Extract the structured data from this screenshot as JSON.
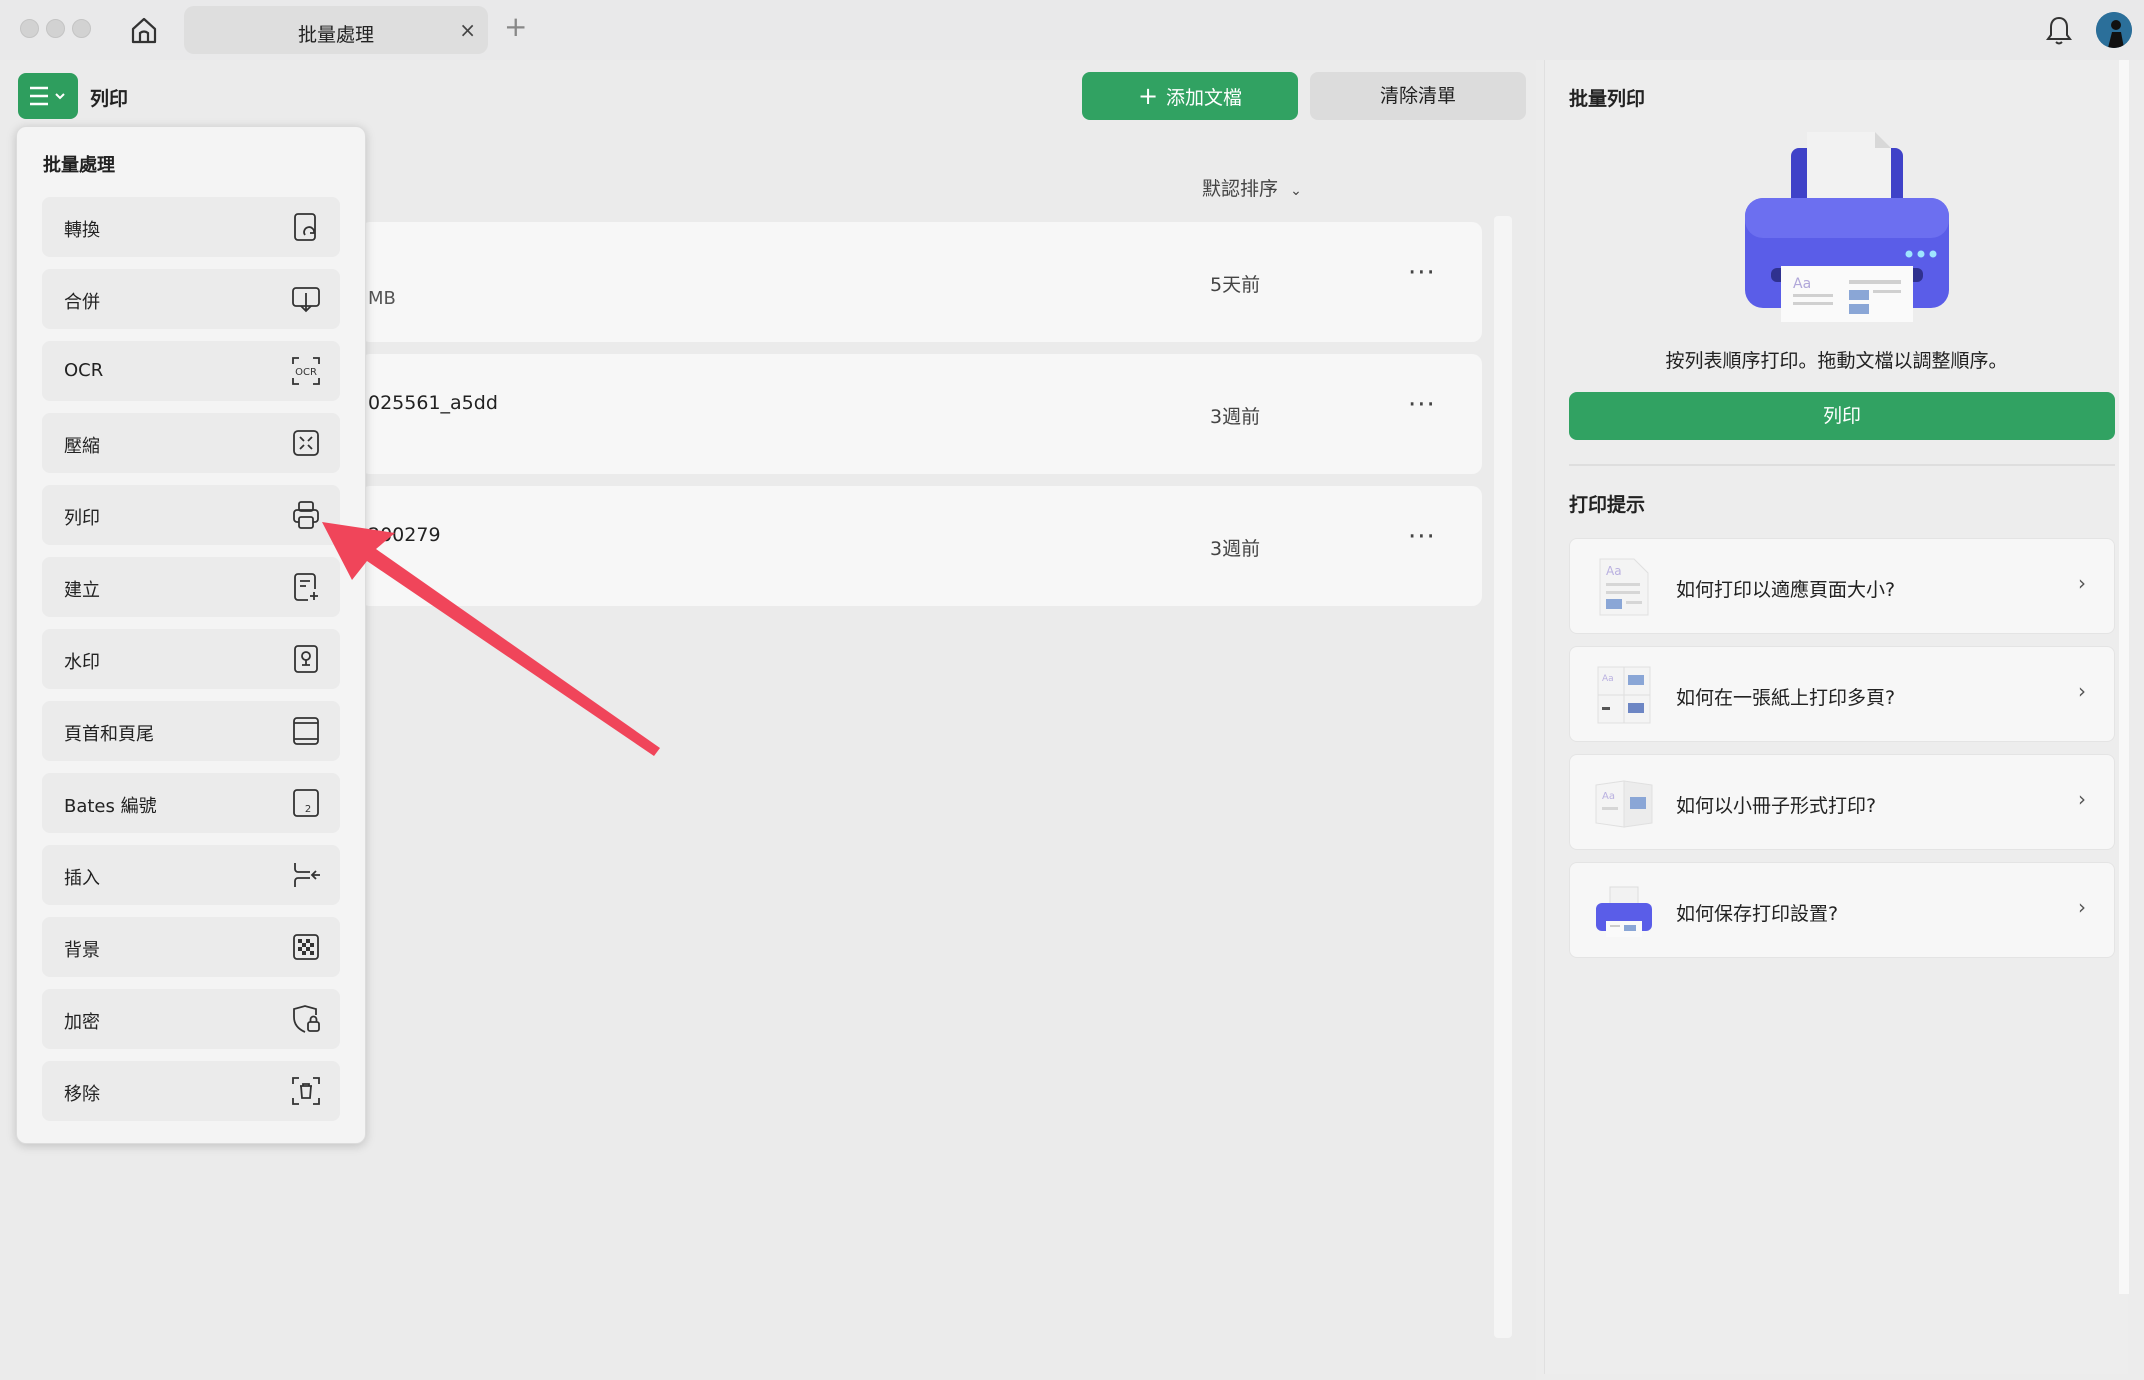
{
  "titlebar": {
    "tab_label": "批量處理",
    "tab_close": "×",
    "tab_add": "+"
  },
  "toolbar": {
    "page_title": "列印",
    "add_label": "添加文檔",
    "clear_label": "清除清單",
    "sort_label": "默認排序"
  },
  "files": [
    {
      "name": "",
      "size": "MB",
      "time": "5天前",
      "more": "···"
    },
    {
      "name": "025561_a5dd",
      "size": "",
      "time": "3週前",
      "more": "···"
    },
    {
      "name": "200279",
      "size": "",
      "time": "3週前",
      "more": "···"
    }
  ],
  "dropdown": {
    "title": "批量處理",
    "items": [
      {
        "label": "轉換",
        "icon": "convert-icon"
      },
      {
        "label": "合併",
        "icon": "merge-icon"
      },
      {
        "label": "OCR",
        "icon": "ocr-icon"
      },
      {
        "label": "壓縮",
        "icon": "compress-icon"
      },
      {
        "label": "列印",
        "icon": "printer-icon"
      },
      {
        "label": "建立",
        "icon": "create-icon"
      },
      {
        "label": "水印",
        "icon": "watermark-icon"
      },
      {
        "label": "頁首和頁尾",
        "icon": "header-footer-icon"
      },
      {
        "label": "Bates 編號",
        "icon": "bates-number-icon"
      },
      {
        "label": "插入",
        "icon": "insert-icon"
      },
      {
        "label": "背景",
        "icon": "background-icon"
      },
      {
        "label": "加密",
        "icon": "encrypt-icon"
      },
      {
        "label": "移除",
        "icon": "remove-icon"
      }
    ]
  },
  "right_panel": {
    "title": "批量列印",
    "description": "按列表順序打印。拖動文檔以調整順序。",
    "print_label": "列印",
    "tips_title": "打印提示",
    "tips": [
      {
        "label": "如何打印以適應頁面大小?",
        "chevron": "›"
      },
      {
        "label": "如何在一張紙上打印多頁?",
        "chevron": "›"
      },
      {
        "label": "如何以小冊子形式打印?",
        "chevron": "›"
      },
      {
        "label": "如何保存打印設置?",
        "chevron": "›"
      }
    ]
  },
  "colors": {
    "accent_green": "#31a262",
    "arrow_red": "#f0455a",
    "printer_blue": "#5a5de8"
  }
}
